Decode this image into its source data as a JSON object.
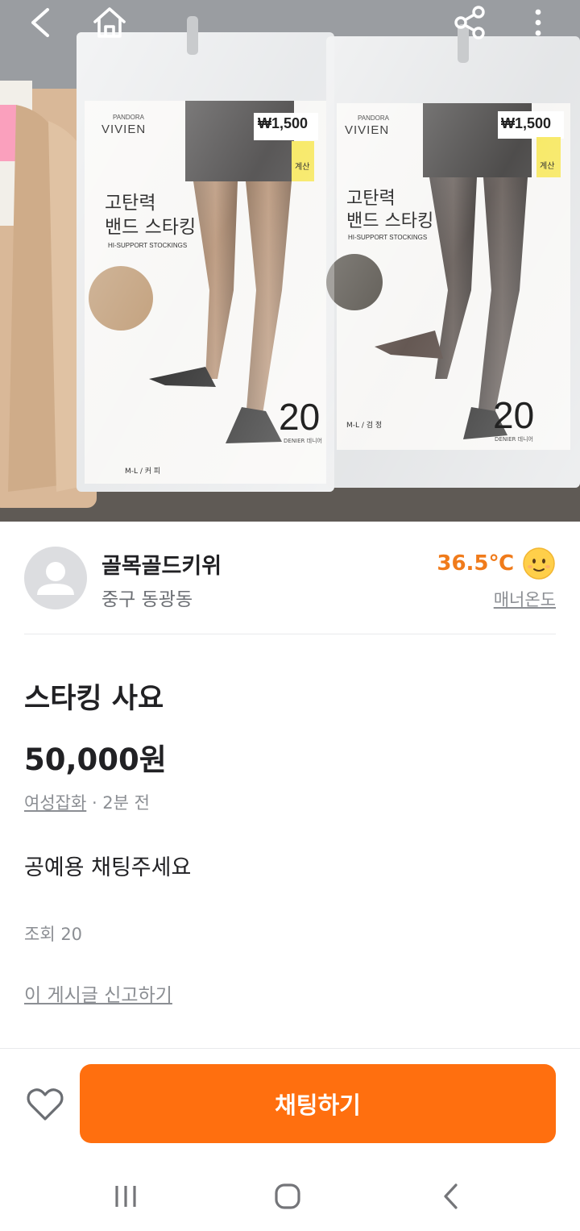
{
  "photo": {
    "package_left": {
      "brand_small": "PANDORA",
      "brand": "VIVIEN",
      "price_tag": "₩1,500",
      "name_line1": "고탄력",
      "name_line2": "밴드 스타킹",
      "subtitle": "HI-SUPPORT STOCKINGS",
      "denier": "20",
      "denier_label": "DENIER 데니어",
      "size": "M-L / 커 피",
      "register_tag": "계산"
    },
    "package_right": {
      "brand_small": "PANDORA",
      "brand": "VIVIEN",
      "price_tag": "₩1,500",
      "name_line1": "고탄력",
      "name_line2": "밴드 스타킹",
      "subtitle": "HI-SUPPORT STOCKINGS",
      "denier": "20",
      "denier_label": "DENIER 데니어",
      "size": "M-L / 검 정",
      "register_tag": "계산"
    }
  },
  "seller": {
    "nickname": "골목골드키위",
    "region": "중구 동광동",
    "temperature": "36.5℃",
    "manner_label": "매너온도"
  },
  "post": {
    "title": "스타킹 사요",
    "price": "50,000원",
    "category": "여성잡화",
    "time_ago": " · 2분 전",
    "description": "공예용 채팅주세요",
    "views": "조회 20",
    "report_link": "이 게시글 신고하기"
  },
  "actions": {
    "chat_button": "채팅하기"
  },
  "colors": {
    "accent": "#ff6f0f",
    "temperature": "#f07b1b"
  },
  "icons": [
    "back-icon",
    "home-icon",
    "share-icon",
    "more-icon",
    "heart-icon",
    "recent-apps-icon",
    "home-nav-icon",
    "back-nav-icon"
  ]
}
